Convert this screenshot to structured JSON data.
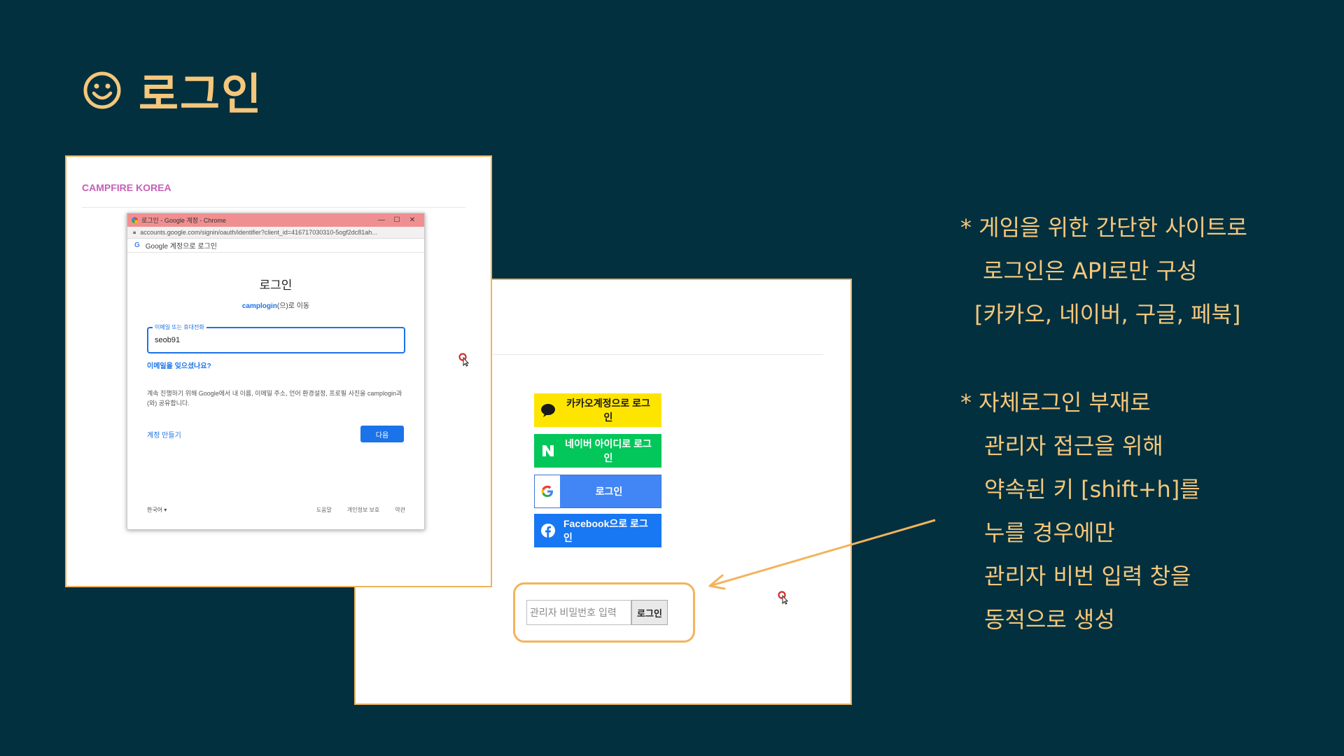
{
  "slide": {
    "title": "로그인",
    "title_icon": "smiley-icon",
    "accent_color": "#f4c77c",
    "background_color": "#03303f"
  },
  "screenshot_google": {
    "brand": "CAMPFIRE KOREA",
    "window_title": "로그인 - Google 계정 - Chrome",
    "url": "accounts.google.com/signin/oauth/identifier?client_id=416717030310-5ogf2dc81ah...",
    "google_bar": "Google 계정으로 로그인",
    "heading": "로그인",
    "subtitle_link": "camplogin",
    "subtitle_rest": "(으)로 이동",
    "email_label": "이메일 또는 휴대전화",
    "email_value": "seob91",
    "forgot_email": "이메일을 잊으셨나요?",
    "notice": "계속 진행하기 위해 Google에서 내 이름, 이메일 주소, 언어 환경설정, 프로필 사진을 camplogin과(와) 공유합니다.",
    "create_account": "계정 만들기",
    "next_button": "다음",
    "language": "한국어 ▾",
    "footer_links": [
      "도움말",
      "개인정보 보호",
      "약관"
    ]
  },
  "screenshot_login": {
    "kakao_label": "카카오계정으로 로그인",
    "naver_label": "네이버 아이디로 로그인",
    "google_label": "로그인",
    "facebook_label": "Facebook으로 로그인",
    "admin_placeholder": "관리자 비밀번호 입력",
    "admin_button": "로그인",
    "colors": {
      "kakao": "#fee500",
      "naver": "#03c75a",
      "google": "#4285f4",
      "facebook": "#1877f2",
      "highlight": "#f4b35c"
    }
  },
  "notes": {
    "n1": "* 게임을 위한 간단한 사이트로",
    "n2": "로그인은 API로만 구성",
    "n3": "[카카오, 네이버, 구글, 페북]",
    "n4": "* 자체로그인 부재로",
    "n5": "관리자 접근을 위해",
    "n6": "약속된 키 [shift+h]를",
    "n7": "누를 경우에만",
    "n8": "관리자 비번 입력 창을",
    "n9": "동적으로 생성"
  }
}
